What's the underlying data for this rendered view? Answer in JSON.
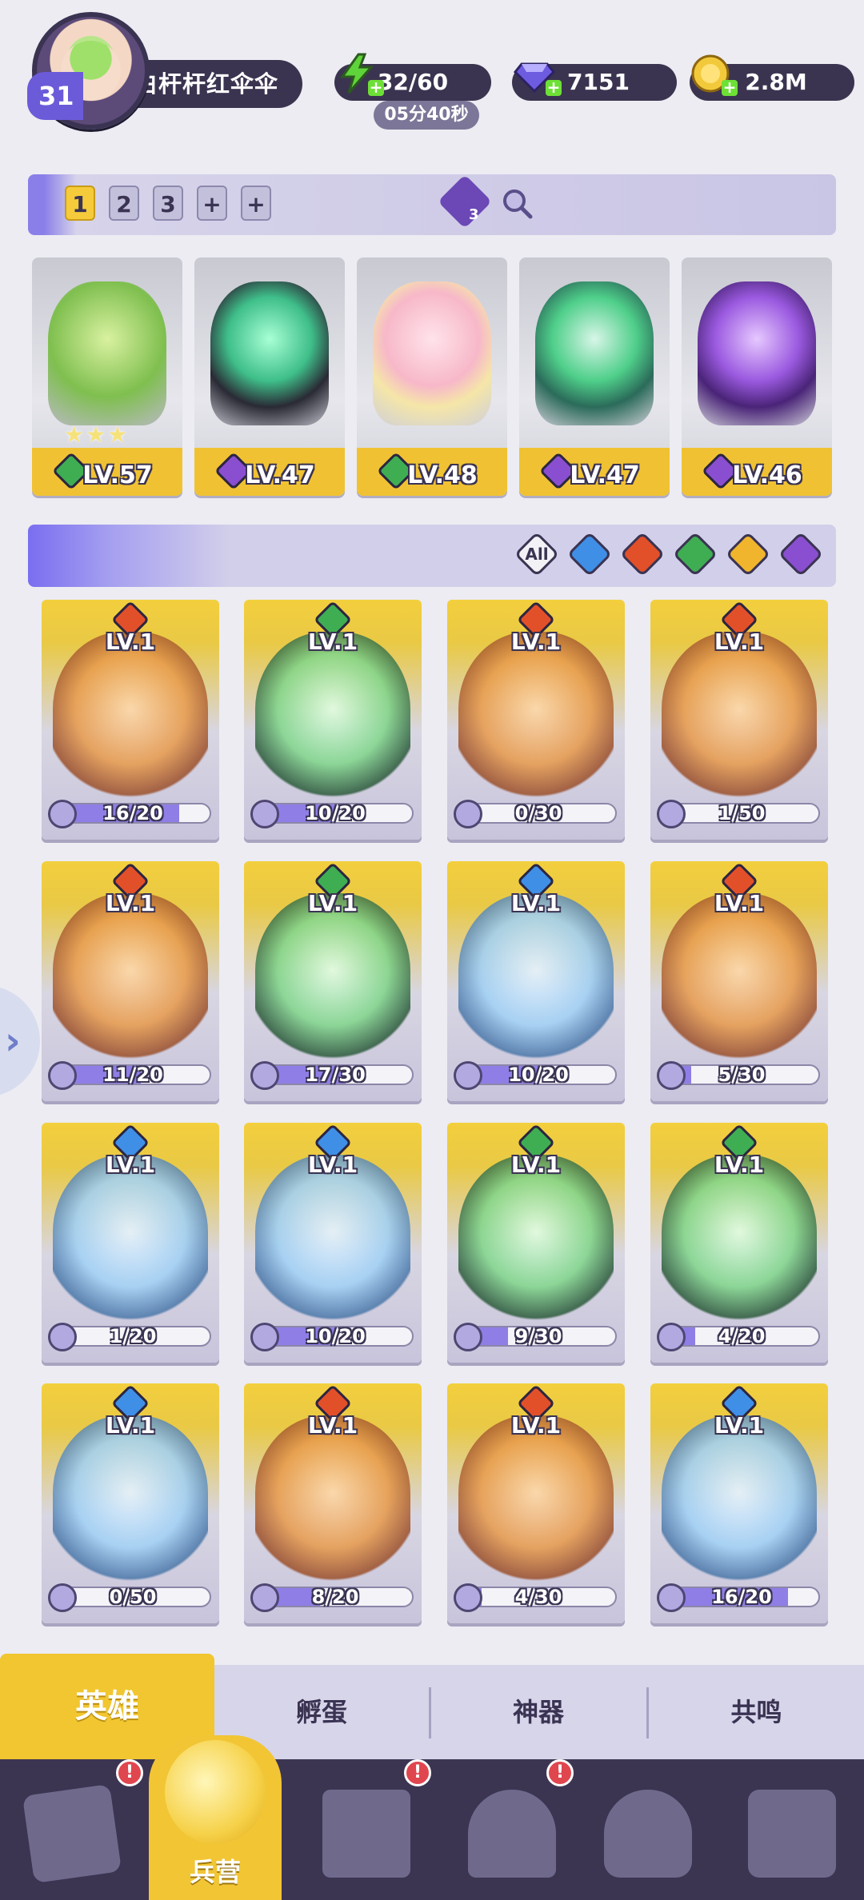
{
  "player": {
    "level": "31",
    "name": "白杆杆红伞伞"
  },
  "resources": {
    "energy": "32/60",
    "energy_timer": "05分40秒",
    "gems": "7151",
    "gold": "2.8M"
  },
  "team": {
    "tabs": [
      "1",
      "2",
      "3",
      "+",
      "+"
    ],
    "formation_count": "3",
    "cards": [
      {
        "level": "LV.57",
        "element": "green",
        "stars": "★★★"
      },
      {
        "level": "LV.47",
        "element": "purple",
        "stars": ""
      },
      {
        "level": "LV.48",
        "element": "green",
        "stars": ""
      },
      {
        "level": "LV.47",
        "element": "purple",
        "stars": ""
      },
      {
        "level": "LV.46",
        "element": "purple",
        "stars": ""
      }
    ]
  },
  "filters": {
    "all_label": "All",
    "items": [
      "all",
      "water",
      "fire",
      "nature",
      "light",
      "dark"
    ]
  },
  "heroes": [
    {
      "level": "LV.1",
      "element": "fire",
      "progress": "16/20",
      "fraction": 0.8
    },
    {
      "level": "LV.1",
      "element": "nature",
      "progress": "10/20",
      "fraction": 0.5
    },
    {
      "level": "LV.1",
      "element": "fire",
      "progress": "0/30",
      "fraction": 0.0
    },
    {
      "level": "LV.1",
      "element": "fire",
      "progress": "1/50",
      "fraction": 0.02
    },
    {
      "level": "LV.1",
      "element": "fire",
      "progress": "11/20",
      "fraction": 0.55
    },
    {
      "level": "LV.1",
      "element": "nature",
      "progress": "17/30",
      "fraction": 0.57
    },
    {
      "level": "LV.1",
      "element": "water",
      "progress": "10/20",
      "fraction": 0.5
    },
    {
      "level": "LV.1",
      "element": "fire",
      "progress": "5/30",
      "fraction": 0.17
    },
    {
      "level": "LV.1",
      "element": "water",
      "progress": "1/20",
      "fraction": 0.05
    },
    {
      "level": "LV.1",
      "element": "water",
      "progress": "10/20",
      "fraction": 0.5
    },
    {
      "level": "LV.1",
      "element": "nature",
      "progress": "9/30",
      "fraction": 0.3
    },
    {
      "level": "LV.1",
      "element": "nature",
      "progress": "4/20",
      "fraction": 0.2
    },
    {
      "level": "LV.1",
      "element": "water",
      "progress": "0/50",
      "fraction": 0.0
    },
    {
      "level": "LV.1",
      "element": "fire",
      "progress": "8/20",
      "fraction": 0.4
    },
    {
      "level": "LV.1",
      "element": "fire",
      "progress": "4/30",
      "fraction": 0.13
    },
    {
      "level": "LV.1",
      "element": "water",
      "progress": "16/20",
      "fraction": 0.8
    }
  ],
  "section_tabs": [
    "英雄",
    "孵蛋",
    "神器",
    "共鸣"
  ],
  "bottom_nav": {
    "active_label": "兵营",
    "badges": [
      "!",
      "!",
      "!"
    ]
  },
  "colors": {
    "fire": "#e2502a",
    "water": "#3f8fe6",
    "nature": "#3fae52",
    "light": "#f0b52c",
    "dark": "#8a4fd0",
    "green": "#3fae52",
    "purple": "#8a4fd0",
    "gold": "#f1c630"
  }
}
